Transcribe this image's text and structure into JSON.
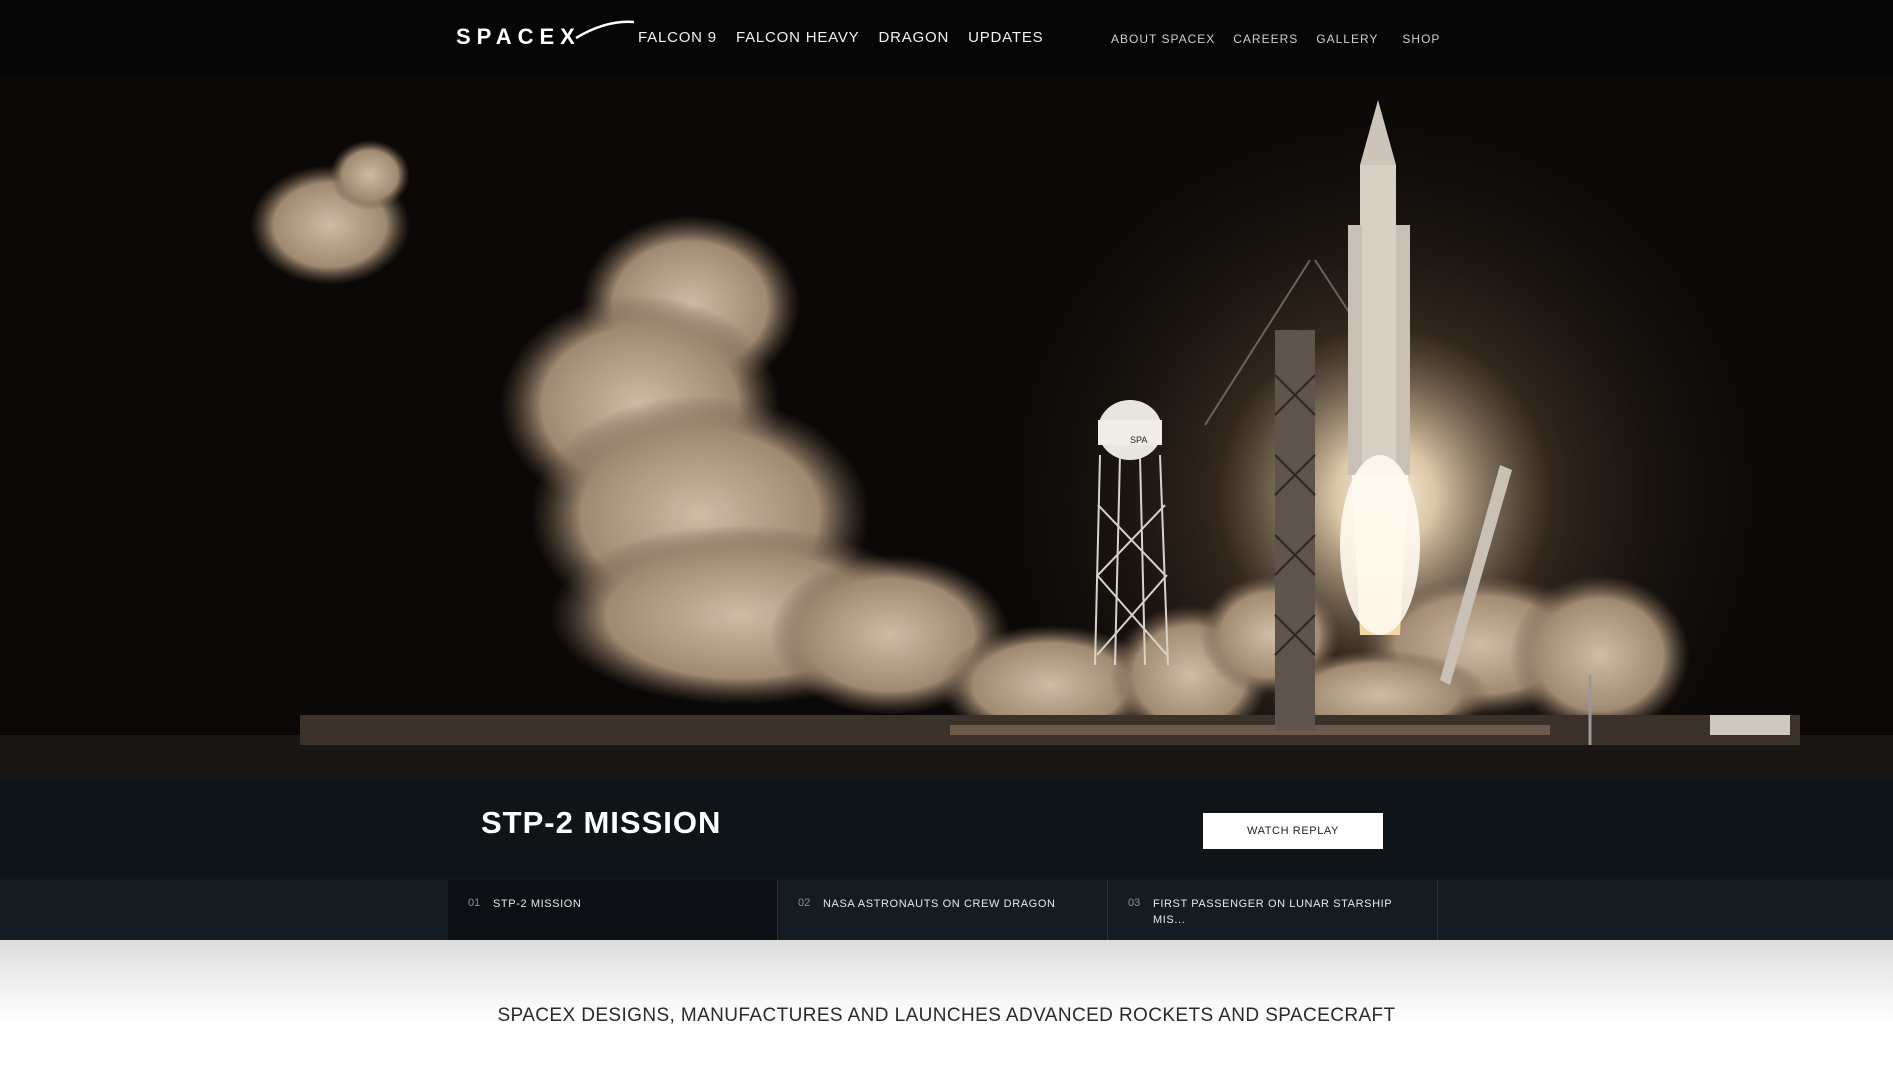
{
  "brand": {
    "logo_text": "SPACEX"
  },
  "nav": {
    "primary": [
      "FALCON 9",
      "FALCON HEAVY",
      "DRAGON",
      "UPDATES"
    ],
    "secondary": [
      "ABOUT SPACEX",
      "CAREERS",
      "GALLERY",
      "SHOP"
    ]
  },
  "hero": {
    "mission_title": "STP-2 MISSION",
    "watch_button": "WATCH REPLAY",
    "tower_label": "SPA"
  },
  "stories": [
    {
      "num": "01",
      "label": "STP-2 MISSION"
    },
    {
      "num": "02",
      "label": "NASA ASTRONAUTS ON CREW DRAGON"
    },
    {
      "num": "03",
      "label": "FIRST PASSENGER ON LUNAR STARSHIP MIS..."
    }
  ],
  "tagline": "SPACEX DESIGNS, MANUFACTURES AND LAUNCHES ADVANCED ROCKETS AND SPACECRAFT",
  "colors": {
    "nav_bg": "#060606",
    "mission_bar": "#0e141a",
    "story_bg": "#141b21",
    "button_bg": "#ffffff"
  }
}
